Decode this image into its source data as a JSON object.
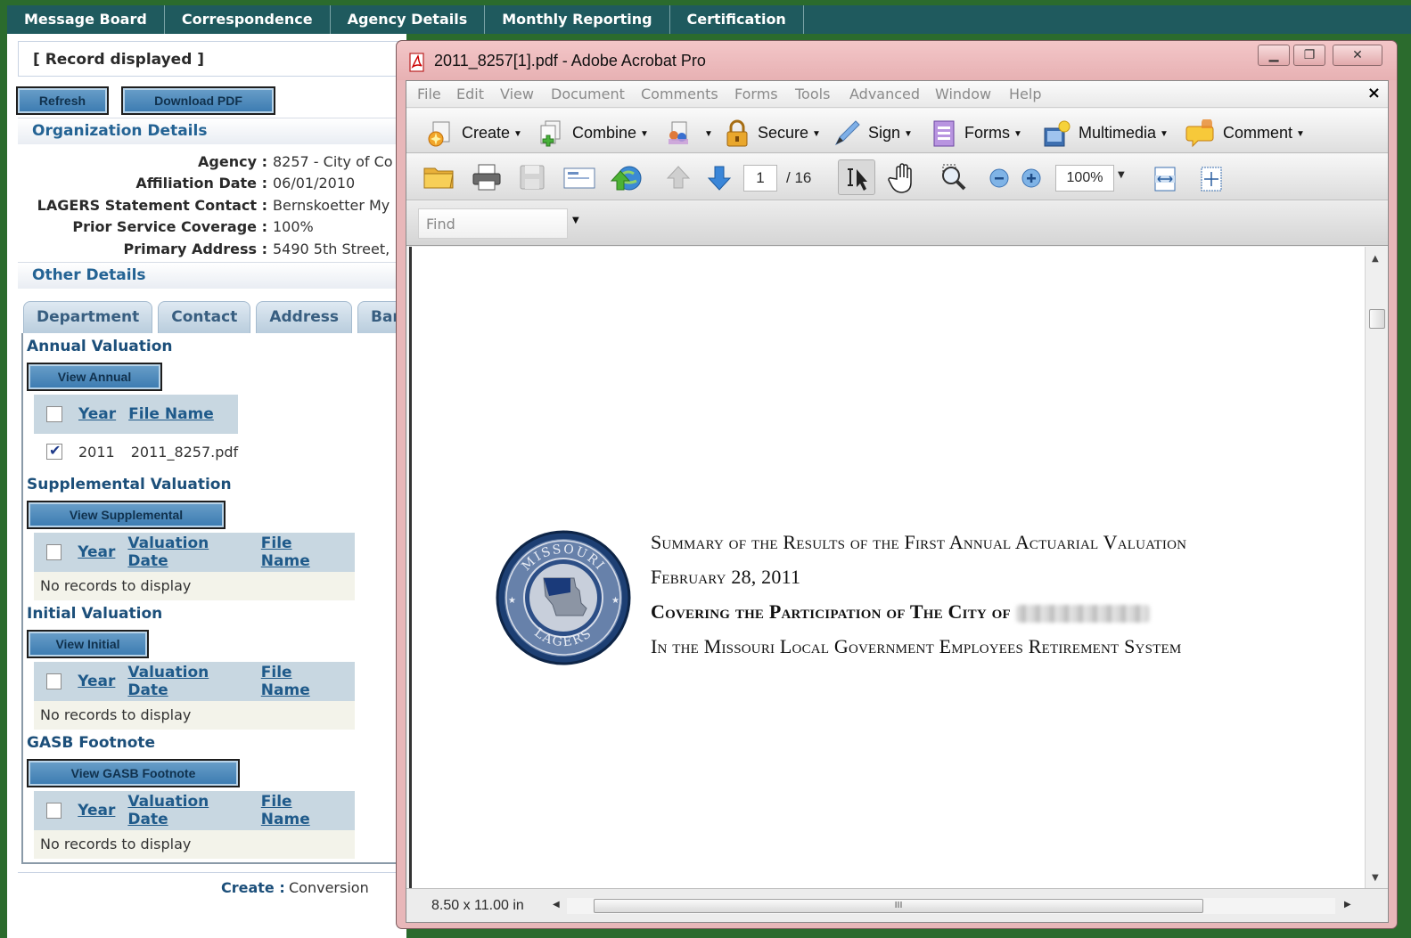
{
  "nav": [
    "Message Board",
    "Correspondence",
    "Agency Details",
    "Monthly Reporting",
    "Certification"
  ],
  "record": {
    "status": "[ Record displayed ]"
  },
  "buttons": {
    "refresh": "Refresh",
    "download_pdf": "Download PDF"
  },
  "org": {
    "heading": "Organization Details",
    "rows": [
      {
        "label": "Agency :",
        "value": "8257 - City of Co"
      },
      {
        "label": "Affiliation Date :",
        "value": "06/01/2010"
      },
      {
        "label": "LAGERS Statement Contact :",
        "value": "Bernskoetter My"
      },
      {
        "label": "Prior Service Coverage :",
        "value": "100%"
      },
      {
        "label": "Primary Address :",
        "value": "5490 5th Street,"
      }
    ]
  },
  "other": {
    "heading": "Other Details",
    "tabs": [
      "Department",
      "Contact",
      "Address",
      "Bank"
    ]
  },
  "annual": {
    "title": "Annual Valuation",
    "button": "View Annual",
    "cols": [
      "Year",
      "File Name"
    ],
    "row": {
      "year": "2011",
      "file": "2011_8257.pdf",
      "checked": true
    }
  },
  "supplemental": {
    "title": "Supplemental Valuation",
    "button": "View Supplemental",
    "cols": [
      "Year",
      "Valuation Date",
      "File Name"
    ],
    "empty": "No records to display"
  },
  "initial": {
    "title": "Initial Valuation",
    "button": "View Initial",
    "cols": [
      "Year",
      "Valuation Date",
      "File Name"
    ],
    "empty": "No records to display"
  },
  "gasb": {
    "title": "GASB Footnote",
    "button": "View GASB Footnote",
    "cols": [
      "Year",
      "Valuation Date",
      "File Name"
    ],
    "empty": "No records to display"
  },
  "footer": {
    "label": "Create :",
    "value": "Conversion"
  },
  "acrobat": {
    "title": "2011_8257[1].pdf - Adobe Acrobat Pro",
    "menu": [
      "File",
      "Edit",
      "View",
      "Document",
      "Comments",
      "Forms",
      "Tools",
      "Advanced",
      "Window",
      "Help"
    ],
    "toolbar": {
      "create": "Create",
      "combine": "Combine",
      "secure": "Secure",
      "sign": "Sign",
      "forms": "Forms",
      "multimedia": "Multimedia",
      "comment": "Comment"
    },
    "page_current": "1",
    "page_total": "/ 16",
    "zoom": "100%",
    "find_placeholder": "Find",
    "page_size": "8.50 x 11.00 in",
    "scroll_grip": "III"
  },
  "pdf": {
    "line1": "Summary of the Results of the First Annual Actuarial Valuation",
    "line2": "February 28, 2011",
    "line3": "Covering the Participation of The City of",
    "line4": "In the Missouri Local Government Employees Retirement System",
    "seal_top": "MISSOURI",
    "seal_bottom": "LAGERS"
  },
  "colors": {
    "nav_bg": "#1f5a5e",
    "accent_blue": "#246394",
    "window_pink": "#e8b7b9",
    "page_bg": "#2b6b2d"
  }
}
